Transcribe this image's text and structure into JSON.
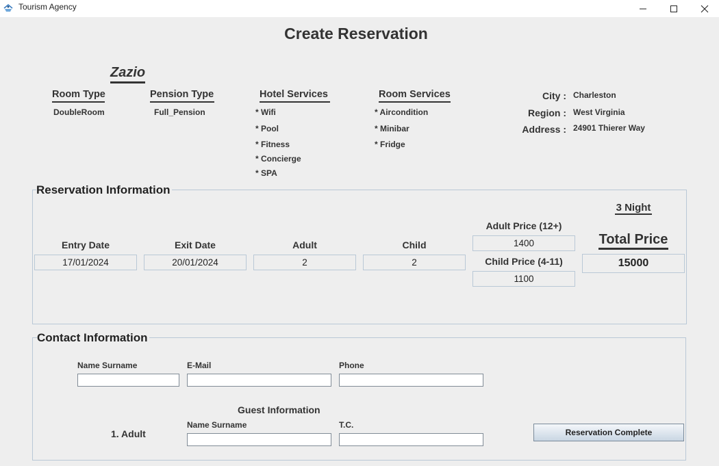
{
  "window": {
    "title": "Tourism Agency"
  },
  "page_title": "Create Reservation",
  "hotel": {
    "name": "Zazio",
    "room_type_label": "Room Type",
    "room_type": "DoubleRoom",
    "pension_type_label": "Pension Type",
    "pension_type": "Full_Pension",
    "hotel_services_label": "Hotel Services",
    "hotel_services": [
      "* Wifi",
      "* Pool",
      "* Fitness",
      "* Concierge",
      "* SPA"
    ],
    "room_services_label": "Room Services",
    "room_services": [
      "* Aircondition",
      "* Minibar",
      "* Fridge"
    ],
    "city_label": "City :",
    "city": "Charleston",
    "region_label": "Region :",
    "region": "West Virginia",
    "address_label": "Address :",
    "address": "24901 Thierer Way"
  },
  "reservation": {
    "title": "Reservation Information",
    "entry_date_label": "Entry Date",
    "entry_date": "17/01/2024",
    "exit_date_label": "Exit Date",
    "exit_date": "20/01/2024",
    "adult_label": "Adult",
    "adult": "2",
    "child_label": "Child",
    "child": "2",
    "adult_price_label": "Adult Price (12+)",
    "adult_price": "1400",
    "child_price_label": "Child Price (4-11)",
    "child_price": "1100",
    "nights": "3 Night",
    "total_price_label": "Total Price",
    "total_price": "15000"
  },
  "contact": {
    "title": "Contact Information",
    "name_label": "Name Surname",
    "name_value": "",
    "email_label": "E-Mail",
    "email_value": "",
    "phone_label": "Phone",
    "phone_value": "",
    "guest_info_label": "Guest Information",
    "guest_label": "1. Adult",
    "guest_name_label": "Name Surname",
    "guest_name_value": "",
    "guest_tc_label": "T.C.",
    "guest_tc_value": "",
    "complete_button": "Reservation Complete"
  }
}
